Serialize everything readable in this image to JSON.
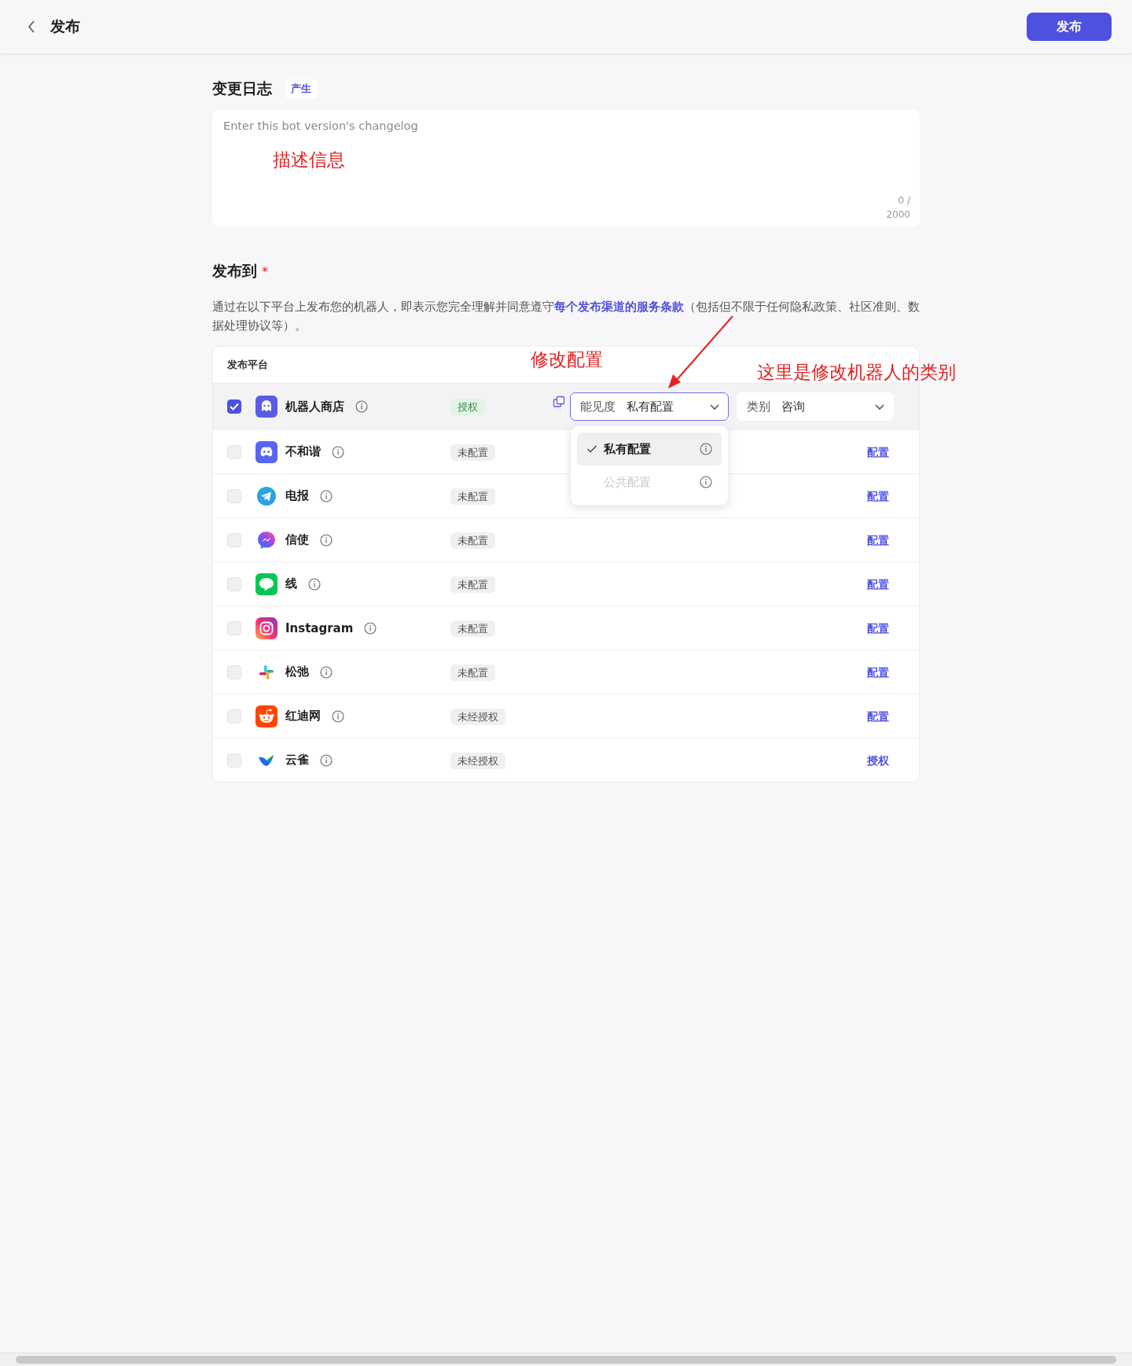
{
  "header": {
    "title": "发布",
    "publish_button": "发布"
  },
  "changelog": {
    "title": "变更日志",
    "generate_button": "产生",
    "placeholder": "Enter this bot version's changelog",
    "counter": "0 / 2000"
  },
  "publish_to": {
    "title": "发布到",
    "required_mark": "*",
    "description_before": "通过在以下平台上发布您的机器人，即表示您完全理解并同意遵守",
    "terms_link": "每个发布渠道的服务条款",
    "description_after": "（包括但不限于任何隐私政策、社区准则、数据处理协议等）。"
  },
  "table": {
    "header": "发布平台",
    "rows": [
      {
        "kind": "bot-store",
        "name": "机器人商店",
        "checked": true,
        "status": {
          "text": "授权",
          "kind": "authorized"
        },
        "visibility": {
          "label": "能见度",
          "value": "私有配置",
          "expanded": true,
          "options": [
            {
              "label": "私有配置",
              "selected": true,
              "disabled": false
            },
            {
              "label": "公共配置",
              "selected": false,
              "disabled": true
            }
          ]
        },
        "category": {
          "label": "类别",
          "value": "咨询"
        }
      },
      {
        "kind": "discord",
        "name": "不和谐",
        "checked": false,
        "status": {
          "text": "未配置",
          "kind": "unconfigured"
        },
        "action": "配置"
      },
      {
        "kind": "telegram",
        "name": "电报",
        "checked": false,
        "status": {
          "text": "未配置",
          "kind": "unconfigured"
        },
        "action": "配置"
      },
      {
        "kind": "messenger",
        "name": "信使",
        "checked": false,
        "status": {
          "text": "未配置",
          "kind": "unconfigured"
        },
        "action": "配置"
      },
      {
        "kind": "line",
        "name": "线",
        "checked": false,
        "status": {
          "text": "未配置",
          "kind": "unconfigured"
        },
        "action": "配置"
      },
      {
        "kind": "instagram",
        "name": "Instagram",
        "checked": false,
        "status": {
          "text": "未配置",
          "kind": "unconfigured"
        },
        "action": "配置"
      },
      {
        "kind": "slack",
        "name": "松弛",
        "checked": false,
        "status": {
          "text": "未配置",
          "kind": "unconfigured"
        },
        "action": "配置"
      },
      {
        "kind": "reddit",
        "name": "红迪网",
        "checked": false,
        "status": {
          "text": "未经授权",
          "kind": "unauthorized"
        },
        "action": "配置"
      },
      {
        "kind": "yuque",
        "name": "云雀",
        "checked": false,
        "status": {
          "text": "未经授权",
          "kind": "unauthorized"
        },
        "action": "授权"
      }
    ]
  },
  "annotations": {
    "description_note": "描述信息",
    "config_note": "修改配置",
    "category_note": "这里是修改机器人的类别"
  }
}
